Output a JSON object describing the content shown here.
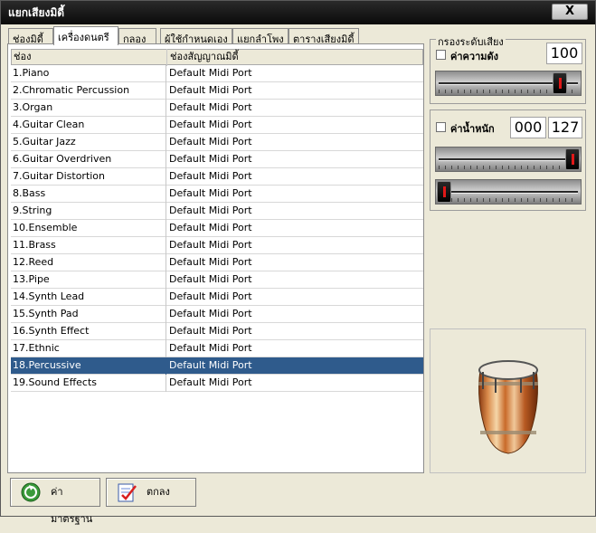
{
  "window": {
    "title": "แยกเสียงมิดี้",
    "close_label": "X"
  },
  "tabs": [
    {
      "label": "ช่องมิดี้",
      "active": false
    },
    {
      "label": "เครื่องดนตรี",
      "active": true
    },
    {
      "label": "กลอง",
      "active": false
    },
    {
      "label": "ผู้ใช้กำหนดเอง",
      "active": false
    },
    {
      "label": "แยกลำโพง",
      "active": false
    },
    {
      "label": "ตารางเสียงมิดี้",
      "active": false
    }
  ],
  "table": {
    "headers": [
      "ช่อง",
      "ช่องสัญญาณมิดี้"
    ],
    "rows": [
      [
        "1.Piano",
        "Default Midi Port"
      ],
      [
        "2.Chromatic Percussion",
        "Default Midi Port"
      ],
      [
        "3.Organ",
        "Default Midi Port"
      ],
      [
        "4.Guitar Clean",
        "Default Midi Port"
      ],
      [
        "5.Guitar Jazz",
        "Default Midi Port"
      ],
      [
        "6.Guitar Overdriven",
        "Default Midi Port"
      ],
      [
        "7.Guitar Distortion",
        "Default Midi Port"
      ],
      [
        "8.Bass",
        "Default Midi Port"
      ],
      [
        "9.String",
        "Default Midi Port"
      ],
      [
        "10.Ensemble",
        "Default Midi Port"
      ],
      [
        "11.Brass",
        "Default Midi Port"
      ],
      [
        "12.Reed",
        "Default Midi Port"
      ],
      [
        "13.Pipe",
        "Default Midi Port"
      ],
      [
        "14.Synth Lead",
        "Default Midi Port"
      ],
      [
        "15.Synth Pad",
        "Default Midi Port"
      ],
      [
        "16.Synth Effect",
        "Default Midi Port"
      ],
      [
        "17.Ethnic",
        "Default Midi Port"
      ],
      [
        "18.Percussive",
        "Default Midi Port"
      ],
      [
        "19.Sound Effects",
        "Default Midi Port"
      ]
    ],
    "selected_row": 17
  },
  "filter": {
    "group_title": "กรองระดับเสียง",
    "volume": {
      "label": "ค่าความดัง",
      "checked": false,
      "value": "100",
      "level": 0.9
    },
    "weight": {
      "label": "ค่าน้ำหนัก",
      "checked": false,
      "min_value": "000",
      "max_value": "127",
      "max_level": 1.0,
      "min_level": 0.0
    }
  },
  "drum": {
    "icon": "conga-drum-icon"
  },
  "buttons": {
    "default_label": "ค่ามาตรฐาน",
    "ok_label": "ตกลง"
  },
  "colors": {
    "selection": "#2f5b8c",
    "titlebar": "#111111",
    "accent_red": "#e01818"
  }
}
